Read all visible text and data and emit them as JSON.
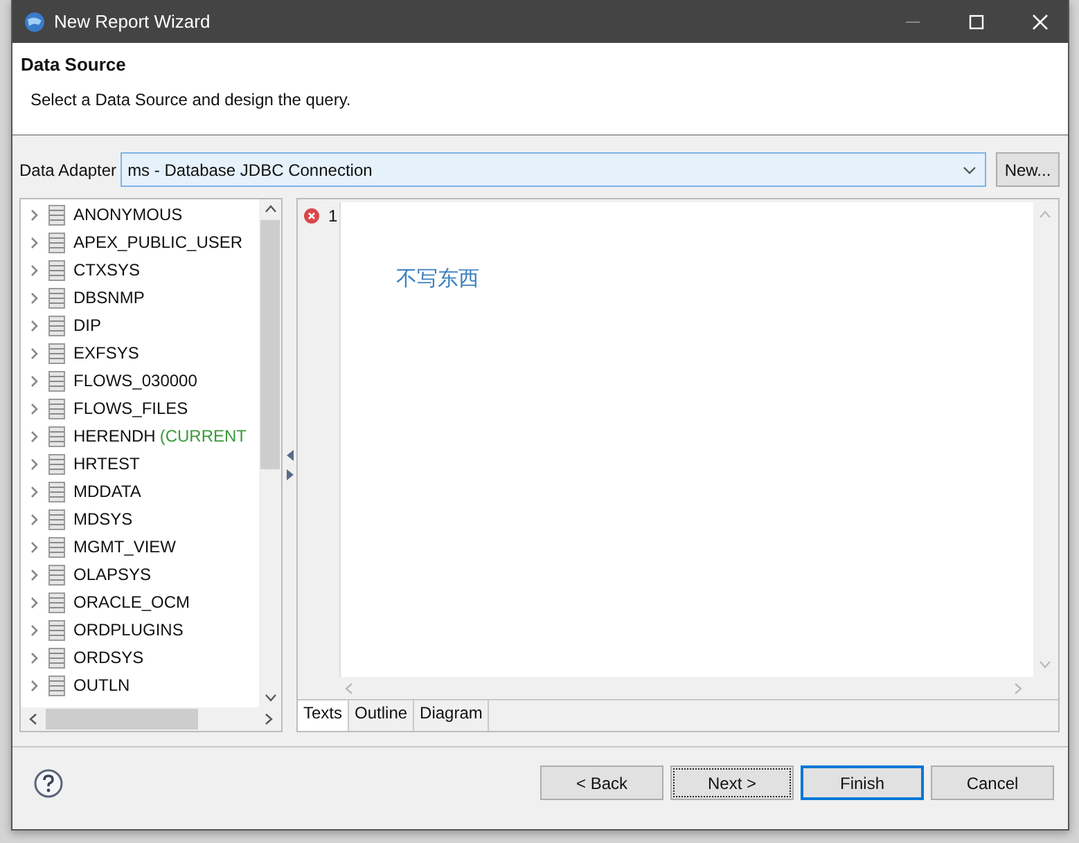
{
  "window": {
    "title": "New Report Wizard"
  },
  "header": {
    "title": "Data Source",
    "description": "Select a Data Source and design the query."
  },
  "data_adapter": {
    "label": "Data Adapter",
    "value": "ms - Database JDBC Connection",
    "new_button": "New..."
  },
  "schema_tree": {
    "items": [
      {
        "label": "ANONYMOUS",
        "expanded": false
      },
      {
        "label": "APEX_PUBLIC_USER",
        "expanded": false
      },
      {
        "label": "CTXSYS",
        "expanded": false
      },
      {
        "label": "DBSNMP",
        "expanded": false
      },
      {
        "label": "DIP",
        "expanded": false
      },
      {
        "label": "EXFSYS",
        "expanded": false
      },
      {
        "label": "FLOWS_030000",
        "expanded": false
      },
      {
        "label": "FLOWS_FILES",
        "expanded": false
      },
      {
        "label": "HERENDH",
        "note": "(CURRENT",
        "expanded": false
      },
      {
        "label": "HRTEST",
        "expanded": false
      },
      {
        "label": "MDDATA",
        "expanded": false
      },
      {
        "label": "MDSYS",
        "expanded": false
      },
      {
        "label": "MGMT_VIEW",
        "expanded": false
      },
      {
        "label": "OLAPSYS",
        "expanded": false
      },
      {
        "label": "ORACLE_OCM",
        "expanded": false
      },
      {
        "label": "ORDPLUGINS",
        "expanded": false
      },
      {
        "label": "ORDSYS",
        "expanded": false
      },
      {
        "label": "OUTLN",
        "expanded": false
      }
    ]
  },
  "editor": {
    "line_numbers": [
      "1"
    ],
    "error": true,
    "text": "不写东西"
  },
  "editor_tabs": [
    {
      "label": "Texts",
      "selected": true
    },
    {
      "label": "Outline",
      "selected": false
    },
    {
      "label": "Diagram",
      "selected": false
    }
  ],
  "buttons": [
    {
      "label": "< Back",
      "focused": false,
      "default": false
    },
    {
      "label": "Next >",
      "focused": true,
      "default": false
    },
    {
      "label": "Finish",
      "focused": false,
      "default": true
    },
    {
      "label": "Cancel",
      "focused": false,
      "default": false
    }
  ]
}
